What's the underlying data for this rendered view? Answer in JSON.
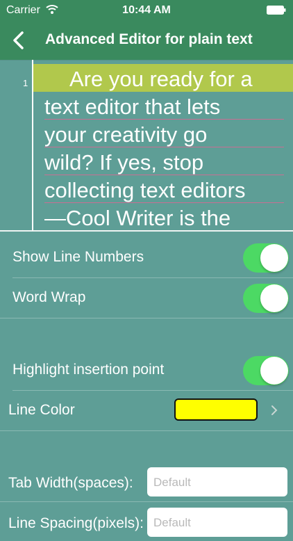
{
  "status_bar": {
    "carrier": "Carrier",
    "time": "10:44 AM"
  },
  "nav": {
    "title": "Advanced Editor for plain text",
    "back_icon": "chevron-left-icon"
  },
  "editor": {
    "line_number": "1",
    "lines": [
      "Are you ready for a",
      "text editor that lets",
      "your creativity go",
      "wild? If yes, stop",
      "collecting text editors",
      "—Cool Writer is the"
    ]
  },
  "settings": {
    "show_line_numbers": {
      "label": "Show Line Numbers",
      "on": true
    },
    "word_wrap": {
      "label": "Word Wrap",
      "on": true
    },
    "highlight_insertion": {
      "label": "Highlight insertion point",
      "on": true
    },
    "line_color": {
      "label": "Line Color",
      "color": "#ffff00"
    },
    "tab_width": {
      "label": "Tab Width(spaces):",
      "placeholder": "Default"
    },
    "line_spacing": {
      "label": "Line Spacing(pixels):",
      "placeholder": "Default"
    }
  },
  "colors": {
    "background": "#5e9e96",
    "nav": "#3a8a5e",
    "toggle_on": "#4cd964",
    "highlight": "#b1c84c"
  }
}
